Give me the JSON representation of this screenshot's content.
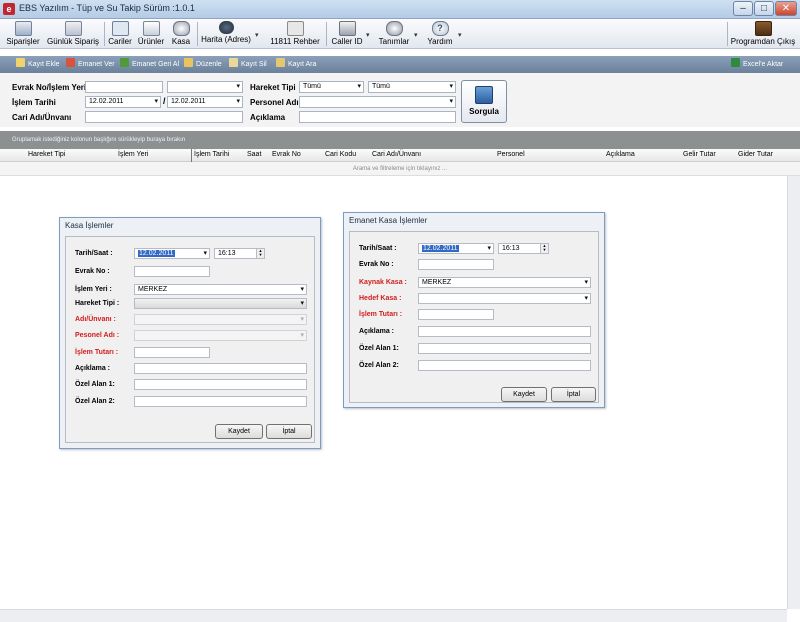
{
  "window": {
    "title": "EBS Yazılım - Tüp ve Su Takip Sürüm :1.0.1",
    "min": "–",
    "max": "□",
    "close": "✕"
  },
  "toolbar": {
    "siparisler": "Siparişler",
    "gunluk": "Günlük Sipariş",
    "cariler": "Cariler",
    "urunler": "Ürünler",
    "kasa": "Kasa",
    "harita": "Harita (Adres)",
    "rehber": "11811 Rehber",
    "callerid": "Caller ID",
    "tanimlar": "Tanımlar",
    "yardim": "Yardım",
    "cikis": "Programdan Çıkış"
  },
  "actions": {
    "kayit_ekle": "Kayıt Ekle",
    "emanet_ver": "Emanet Ver",
    "emanet_geri": "Emanet Geri Al",
    "duzenle": "Düzenle",
    "kayit_sil": "Kayıt Sil",
    "kayit_ara": "Kayıt Ara",
    "excel": "Excel'e Aktar"
  },
  "filter": {
    "evrak_label": "Evrak No/İşlem Yeri",
    "islem_tarihi_label": "İşlem Tarihi",
    "cari_label": "Cari Adı/Ünvanı",
    "hareket_label": "Hareket Tipi",
    "personel_label": "Personel Adı",
    "aciklama_label": "Açıklama",
    "date_from": "12.02.2011",
    "date_to": "12.02.2011",
    "date_sep": "/",
    "hareket_val1": "Tümü",
    "hareket_val2": "Tümü",
    "sorgula": "Sorgula"
  },
  "grid": {
    "group_hint": "Gruplamak istediğiniz kolonun başlığını sürükleyip buraya bırakın",
    "columns": [
      "Hareket Tipi",
      "İşlem Yeri",
      "İşlem Tarihi",
      "Saat",
      "Evrak No",
      "Cari Kodu",
      "Cari Adı/Ünvanı",
      "Personel",
      "Açıklama",
      "Gelir Tutar",
      "Gider Tutar"
    ],
    "filter_hint": "Arama ve filtreleme için tıklayınız ..."
  },
  "kasa_dialog": {
    "title": "Kasa İşlemler",
    "tarih_label": "Tarih/Saat :",
    "tarih_val": "12.02.2011",
    "saat_val": "16:13",
    "evrak_label": "Evrak No :",
    "islem_yeri_label": "İşlem Yeri :",
    "islem_yeri_val": "MERKEZ",
    "hareket_label": "Hareket Tipi :",
    "adi_label": "Adı/Ünvanı :",
    "personel_label": "Pesonel Adı :",
    "tutar_label": "İşlem Tutarı :",
    "aciklama_label": "Açıklama :",
    "ozel1_label": "Özel Alan 1:",
    "ozel2_label": "Özel Alan 2:",
    "kaydet": "Kaydet",
    "iptal": "İptal"
  },
  "emanet_dialog": {
    "title": "Emanet Kasa İşlemler",
    "tarih_label": "Tarih/Saat :",
    "tarih_val": "12.02.2011",
    "saat_val": "16:13",
    "evrak_label": "Evrak No :",
    "kaynak_label": "Kaynak Kasa :",
    "kaynak_val": "MERKEZ",
    "hedef_label": "Hedef Kasa :",
    "tutar_label": "İşlem Tutarı :",
    "aciklama_label": "Açıklama :",
    "ozel1_label": "Özel Alan 1:",
    "ozel2_label": "Özel Alan 2:",
    "kaydet": "Kaydet",
    "iptal": "İptal"
  },
  "colors": {
    "required_label": "#d21c1c",
    "action_bar": "#6b8099",
    "selection": "#316ac5"
  }
}
